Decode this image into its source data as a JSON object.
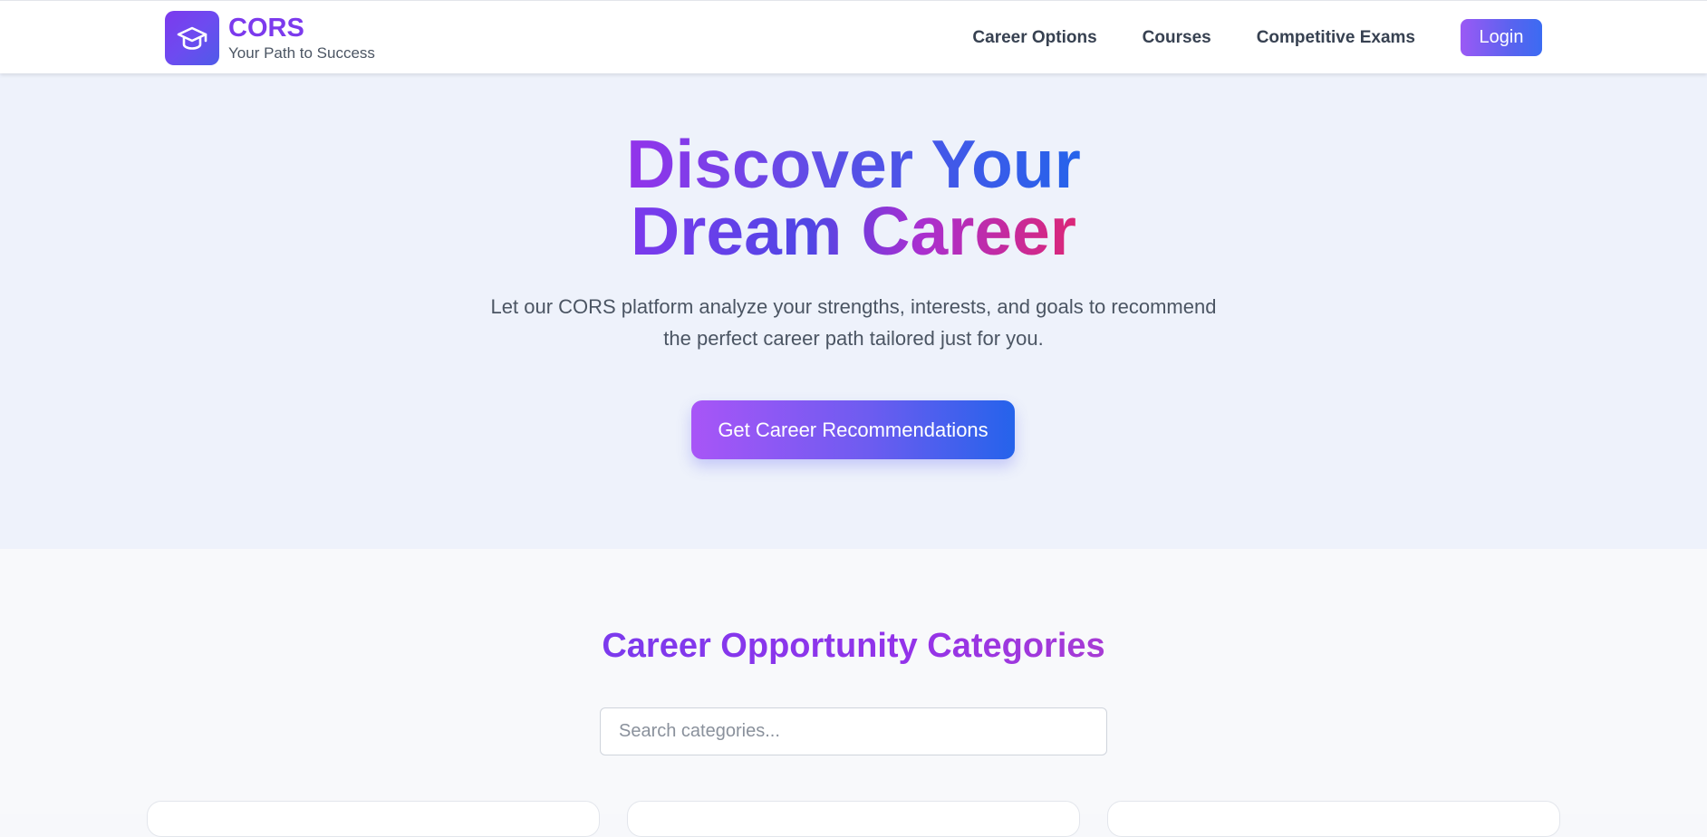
{
  "navbar": {
    "brand_name": "CORS",
    "brand_tagline": "Your Path to Success",
    "logo_icon": "graduation-cap-icon",
    "links": [
      {
        "label": "Career Options"
      },
      {
        "label": "Courses"
      },
      {
        "label": "Competitive Exams"
      }
    ],
    "login_label": "Login"
  },
  "hero": {
    "title_line1": "Discover Your",
    "title_line2": "Dream Career",
    "subtitle_line1": "Let our CORS platform analyze your strengths, interests, and goals to recommend",
    "subtitle_line2": "the perfect career path tailored just for you.",
    "cta_label": "Get Career Recommendations"
  },
  "categories": {
    "heading": "Career Opportunity Categories",
    "search": {
      "placeholder": "Search categories...",
      "value": ""
    }
  },
  "colors": {
    "accent_purple": "#7c3aed",
    "accent_blue": "#2563eb",
    "accent_pink": "#db2777",
    "hero_bg": "#eef2fb"
  }
}
